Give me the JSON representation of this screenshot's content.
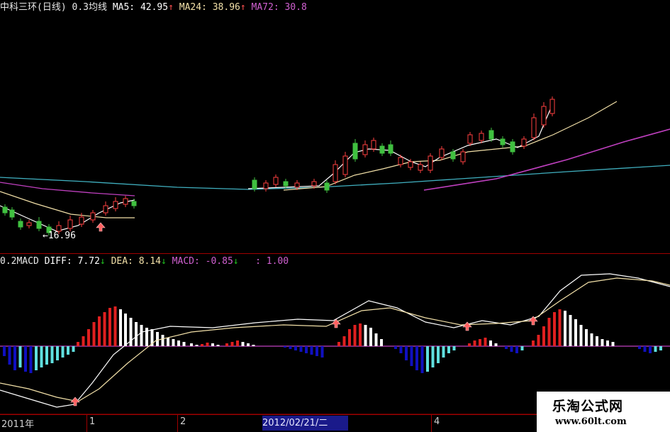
{
  "price_panel": {
    "stock_name": "中科三环",
    "period": "(日线)",
    "indicator": "0.3均线",
    "ma5_label": "MA5:",
    "ma5_value": "42.95",
    "ma5_arrow": "↑",
    "ma24_label": "MA24:",
    "ma24_value": "38.96",
    "ma24_arrow": "↑",
    "ma72_label": "MA72:",
    "ma72_value": "30.8",
    "low_annotation": "←16.96"
  },
  "macd_panel": {
    "prefix": "0.2MACD",
    "diff_label": "DIFF:",
    "diff_value": "7.72",
    "diff_arrow": "↓",
    "dea_label": "DEA:",
    "dea_value": "8.14",
    "dea_arrow": "↓",
    "macd_label": "MACD:",
    "macd_value": "-0.85",
    "macd_arrow": "↓",
    "extra_value": ": 1.00"
  },
  "time_axis": {
    "year_label": "2011年",
    "tick_1": "1",
    "tick_2": "2",
    "cursor_date": "2012/02/21/二",
    "tick_4": "4"
  },
  "watermark": {
    "title": "乐淘公式网",
    "url": "www.60lt.com"
  },
  "colors": {
    "background": "#000000",
    "up_candle": "#ff4040",
    "down_candle": "#40c040",
    "ma5": "#ffffff",
    "ma24": "#f2e0a8",
    "ma72": "#c040c0",
    "long_ma": "#40b0c0",
    "macd_pos": "#e02020",
    "macd_neg": "#1010c0",
    "macd_pos_fade": "#ffffff",
    "macd_neg_fade": "#60e0e0",
    "frame": "#a00000"
  }
}
